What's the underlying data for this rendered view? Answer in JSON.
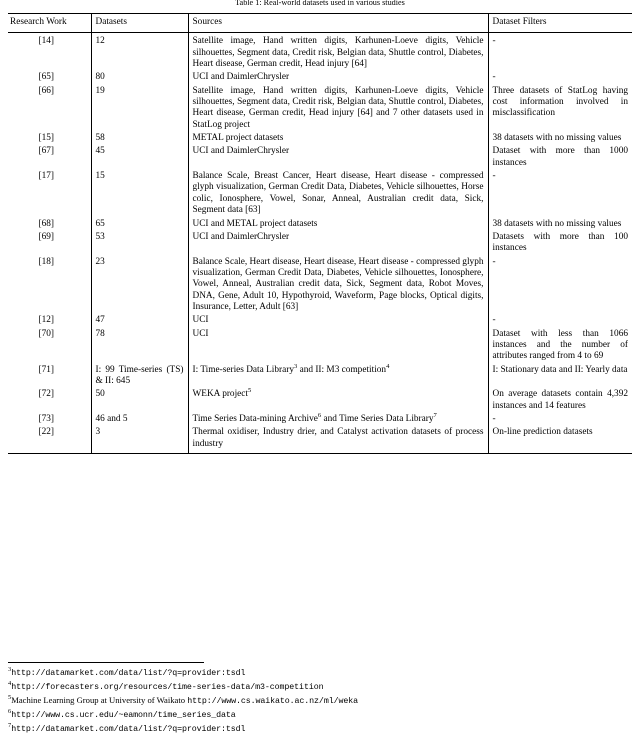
{
  "caption": "Table 1: Real-world datasets used in various studies",
  "table": {
    "headers": {
      "research_work": "Research Work",
      "datasets": "Datasets",
      "sources": "Sources",
      "dataset_filters": "Dataset Filters"
    },
    "rows": [
      {
        "research_work": "[14]",
        "datasets": "12",
        "sources": "Satellite image, Hand written digits, Karhunen-Loeve digits, Vehicle silhouettes, Segment data, Credit risk, Belgian data, Shuttle control, Diabetes, Heart disease, German credit, Head injury [64]",
        "filters": "-"
      },
      {
        "research_work": "[65]",
        "datasets": "80",
        "sources": "UCI and DaimlerChrysler",
        "filters": "-"
      },
      {
        "research_work": "[66]",
        "datasets": "19",
        "sources": "Satellite image, Hand written digits, Karhunen-Loeve digits, Vehicle silhouettes, Segment data, Credit risk, Belgian data, Shuttle control, Diabetes, Heart disease, German credit, Head injury [64] and 7 other datasets used in StatLog project",
        "filters": "Three datasets of StatLog having cost information involved in misclassification"
      },
      {
        "research_work": "[15]",
        "datasets": "58",
        "sources": "METAL project datasets",
        "filters": "38 datasets with no missing values"
      },
      {
        "research_work": "[67]",
        "datasets": "45",
        "sources": "UCI and DaimlerChrysler",
        "filters": "Dataset with more than 1000 instances"
      },
      {
        "research_work": "[17]",
        "datasets": "15",
        "sources": "Balance Scale, Breast Cancer, Heart disease, Heart disease - compressed glyph visualization, German Credit Data, Diabetes, Vehicle silhouettes, Horse colic, Ionosphere, Vowel, Sonar, Anneal, Australian credit data, Sick, Segment data [63]",
        "filters": "-"
      },
      {
        "research_work": "[68]",
        "datasets": "65",
        "sources": "UCI and METAL project datasets",
        "filters": "38 datasets with no missing values"
      },
      {
        "research_work": "[69]",
        "datasets": "53",
        "sources": "UCI and DaimlerChrysler",
        "filters": "Datasets with more than 100 instances"
      },
      {
        "research_work": "[18]",
        "datasets": "23",
        "sources": "Balance Scale, Heart disease, Heart disease, Heart disease - compressed glyph visualization, German Credit Data, Diabetes, Vehicle silhouettes, Ionosphere, Vowel, Anneal, Australian credit data, Sick, Segment data, Robot Moves, DNA, Gene, Adult 10, Hypothyroid, Waveform, Page blocks, Optical digits, Insurance, Letter, Adult [63]",
        "filters": "-"
      },
      {
        "research_work": "[12]",
        "datasets": "47",
        "sources": "UCI",
        "filters": "-"
      },
      {
        "research_work": "[70]",
        "datasets": "78",
        "sources": "UCI",
        "filters": "Dataset with less than 1066 instances and the number of attributes ranged from 4 to 69"
      },
      {
        "research_work": "[71]",
        "datasets": "I: 99 Time-series (TS) & II: 645",
        "sources_pre": "I: Time-series Data Library",
        "sources_sup1": "3",
        "sources_mid": " and II: M3 competition",
        "sources_sup2": "4",
        "filters": "I: Stationary data and II: Yearly data"
      },
      {
        "research_work": "[72]",
        "datasets": "50",
        "sources_pre": "WEKA project",
        "sources_sup1": "5",
        "filters": "On average datasets contain 4,392 instances and 14 features"
      },
      {
        "research_work": "[73]",
        "datasets": "46 and 5",
        "sources_pre": "Time Series Data-mining Archive",
        "sources_sup1": "6",
        "sources_mid": " and Time Series Data Library",
        "sources_sup2": "7",
        "filters": "-"
      },
      {
        "research_work": "[22]",
        "datasets": "3",
        "sources": "Thermal oxidiser, Industry drier, and Catalyst activation datasets of process industry",
        "filters": "On-line prediction datasets"
      }
    ]
  },
  "footnotes": [
    {
      "marker": "3",
      "text": "http://datamarket.com/data/list/?q=provider:tsdl",
      "mono": true
    },
    {
      "marker": "4",
      "text": "http://forecasters.org/resources/time-series-data/m3-competition",
      "mono": true
    },
    {
      "marker": "5",
      "prefix": "Machine Learning Group at University of Waikato ",
      "text": "http://www.cs.waikato.ac.nz/ml/weka",
      "mono": true
    },
    {
      "marker": "6",
      "text": "http://www.cs.ucr.edu/~eamonn/time_series_data",
      "mono": true
    },
    {
      "marker": "7",
      "text": "http://datamarket.com/data/list/?q=provider:tsdl",
      "mono": true
    }
  ]
}
